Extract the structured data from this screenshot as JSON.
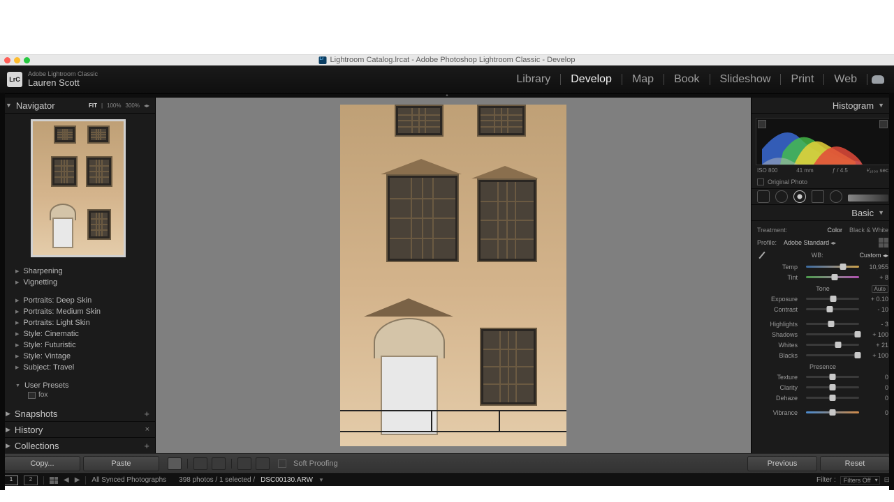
{
  "window": {
    "title": "Lightroom Catalog.lrcat - Adobe Photoshop Lightroom Classic - Develop"
  },
  "identity": {
    "product": "Adobe Lightroom Classic",
    "user": "Lauren Scott",
    "logo": "LrC"
  },
  "modules": [
    "Library",
    "Develop",
    "Map",
    "Book",
    "Slideshow",
    "Print",
    "Web"
  ],
  "active_module": "Develop",
  "navigator": {
    "title": "Navigator",
    "zoom_modes": [
      "FIT",
      "100%",
      "300%"
    ],
    "zoom_active": "FIT"
  },
  "presets": {
    "groups_top": [
      "Sharpening",
      "Vignetting"
    ],
    "groups_mid": [
      "Portraits: Deep Skin",
      "Portraits: Medium Skin",
      "Portraits: Light Skin",
      "Style: Cinematic",
      "Style: Futuristic",
      "Style: Vintage",
      "Subject: Travel"
    ],
    "user_header": "User Presets",
    "user_items": [
      "fox"
    ]
  },
  "left_sections": {
    "snapshots": "Snapshots",
    "history": "History",
    "collections": "Collections"
  },
  "center_toolbar": {
    "copy": "Copy...",
    "paste": "Paste",
    "soft_proof": "Soft Proofing",
    "previous": "Previous",
    "reset": "Reset"
  },
  "histogram": {
    "title": "Histogram",
    "iso": "ISO 800",
    "focal": "41 mm",
    "aperture": "ƒ / 4.5",
    "shutter": "¹⁄₁₆₀₀ sec",
    "original": "Original Photo"
  },
  "basic": {
    "title": "Basic",
    "treatment_label": "Treatment:",
    "treatment_color": "Color",
    "treatment_bw": "Black & White",
    "profile_label": "Profile:",
    "profile_value": "Adobe Standard",
    "wb_label": "WB:",
    "wb_value": "Custom",
    "temp_label": "Temp",
    "temp_value": "10,955",
    "tint_label": "Tint",
    "tint_value": "+ 8",
    "tone_header": "Tone",
    "auto": "Auto",
    "exposure_label": "Exposure",
    "exposure_value": "+ 0.10",
    "contrast_label": "Contrast",
    "contrast_value": "- 10",
    "highlights_label": "Highlights",
    "highlights_value": "- 3",
    "shadows_label": "Shadows",
    "shadows_value": "+ 100",
    "whites_label": "Whites",
    "whites_value": "+ 21",
    "blacks_label": "Blacks",
    "blacks_value": "+ 100",
    "presence_header": "Presence",
    "texture_label": "Texture",
    "texture_value": "0",
    "clarity_label": "Clarity",
    "clarity_value": "0",
    "dehaze_label": "Dehaze",
    "dehaze_value": "0",
    "vibrance_label": "Vibrance",
    "vibrance_value": "0"
  },
  "filmstrip": {
    "source": "All Synced Photographs",
    "count": "398 photos / 1 selected /",
    "file": "DSC00130.ARW",
    "filter_label": "Filter :",
    "filter_value": "Filters Off"
  }
}
